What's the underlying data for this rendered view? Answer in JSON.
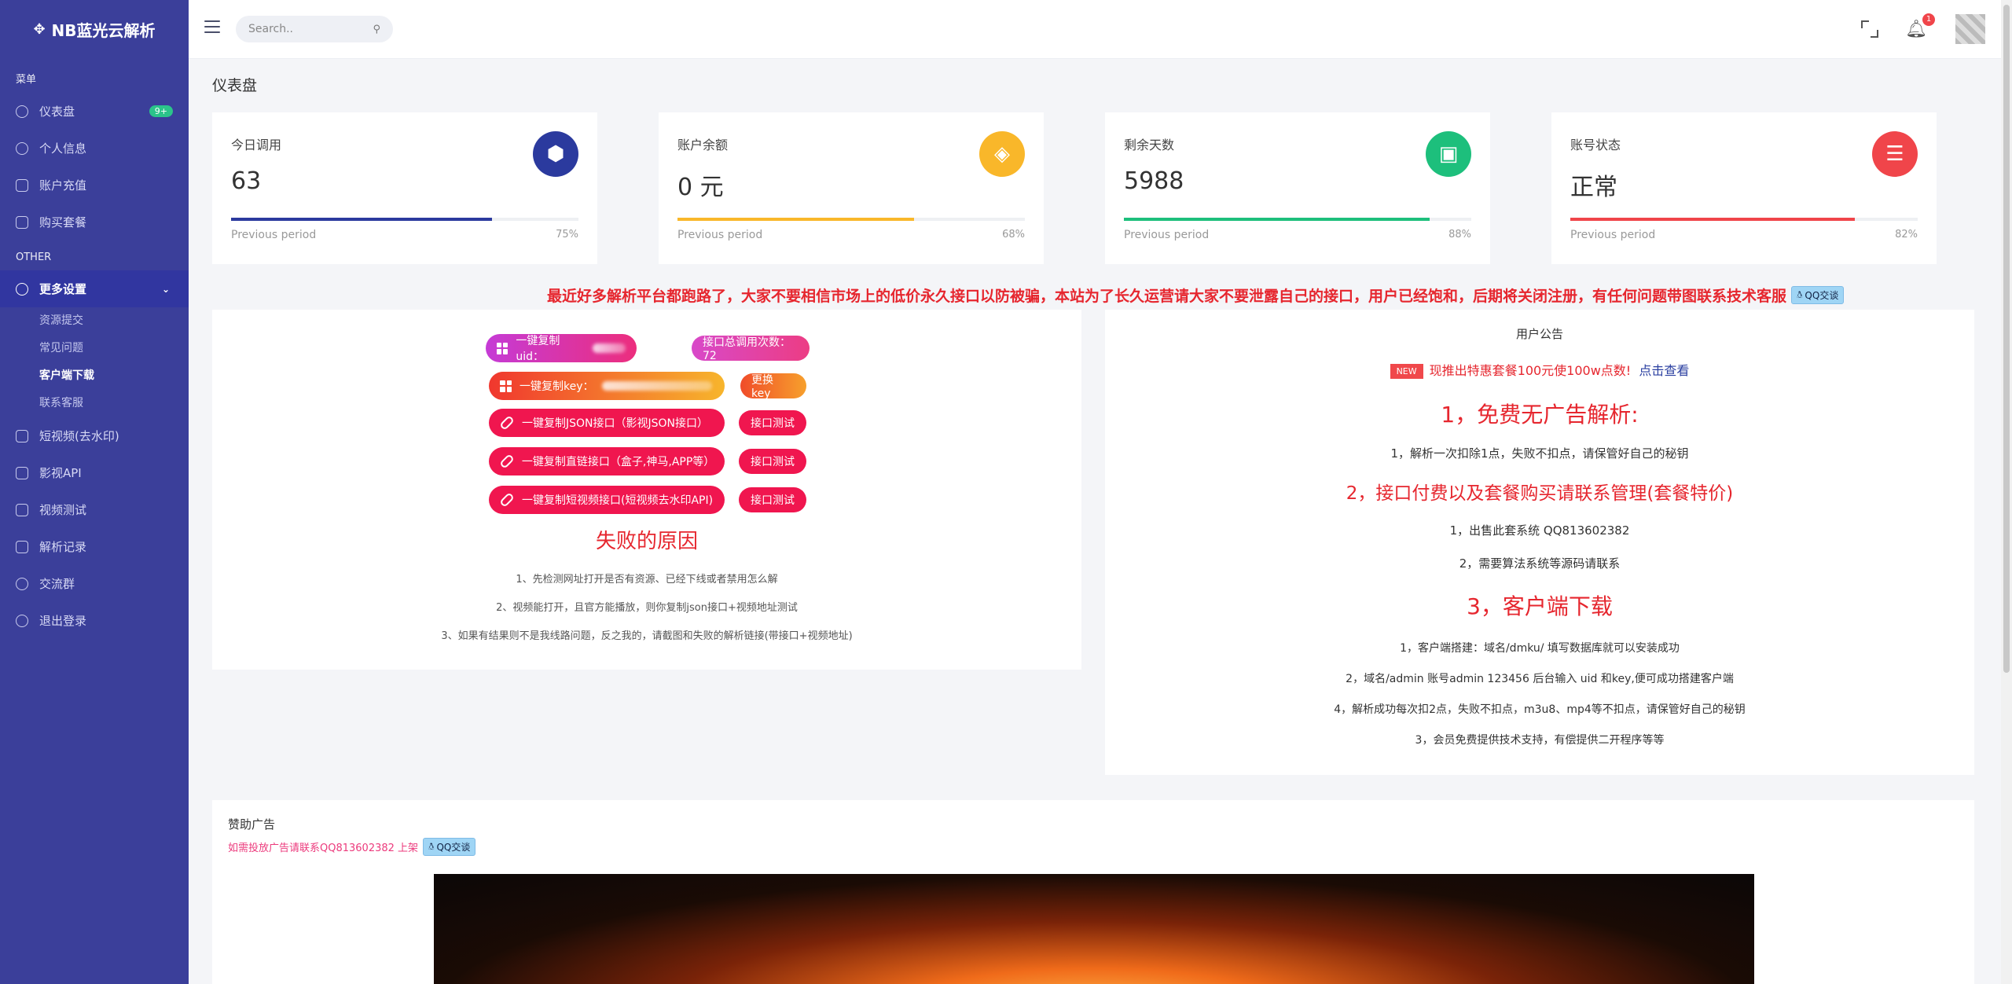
{
  "app": {
    "brand": "NB蓝光云解析"
  },
  "sidebar": {
    "section_menu": "菜单",
    "section_other": "OTHER",
    "items": [
      {
        "label": "仪表盘",
        "badge": "9+"
      },
      {
        "label": "个人信息"
      },
      {
        "label": "账户充值"
      },
      {
        "label": "购买套餐"
      }
    ],
    "more": {
      "label": "更多设置",
      "sub": [
        "资源提交",
        "常见问题",
        "客户端下载",
        "联系客服"
      ]
    },
    "items2": [
      {
        "label": "短视频(去水印)"
      },
      {
        "label": "影视API"
      },
      {
        "label": "视频测试"
      },
      {
        "label": "解析记录"
      },
      {
        "label": "交流群"
      },
      {
        "label": "退出登录"
      }
    ]
  },
  "topbar": {
    "search_placeholder": "Search..",
    "notif_count": "1"
  },
  "page": {
    "title": "仪表盘"
  },
  "stats": [
    {
      "label": "今日调用",
      "value": "63",
      "progress": 0.75,
      "percent": "75%",
      "prev": "Previous period",
      "color": "#2b3a9e",
      "icon": "cube-icon"
    },
    {
      "label": "账户余额",
      "value": "0 元",
      "progress": 0.68,
      "percent": "68%",
      "prev": "Previous period",
      "color": "#f9b72a",
      "icon": "tag-icon"
    },
    {
      "label": "剩余天数",
      "value": "5988",
      "progress": 0.88,
      "percent": "88%",
      "prev": "Previous period",
      "color": "#1dbf7c",
      "icon": "briefcase-icon"
    },
    {
      "label": "账号状态",
      "value": "正常",
      "progress": 0.82,
      "percent": "82%",
      "prev": "Previous period",
      "color": "#f0454a",
      "icon": "layers-icon"
    }
  ],
  "marquee": {
    "text": "最近好多解析平台都跑路了，大家不要相信市场上的低价永久接口以防被骗，本站为了长久运营请大家不要泄露自己的接口，用户已经饱和，后期将关闭注册，有任何问题带图联系技术客服",
    "qq_label": "QQ交谈"
  },
  "api": {
    "copy_uid": "一键复制uid：",
    "total_calls": "接口总调用次数：72",
    "copy_key": "一键复制key：",
    "change_key": "更换 key",
    "copy_json": "一键复制JSON接口（影视JSON接口）",
    "copy_direct": "一键复制直链接口（盒子,神马,APP等）",
    "copy_short": "一键复制短视频接口(短视频去水印API)",
    "test": "接口测试",
    "fail_title": "失败的原因",
    "reasons": [
      "1、先检测网址打开是否有资源、已经下线或者禁用怎么解",
      "2、视频能打开，且官方能播放，则你复制json接口+视频地址测试",
      "3、如果有结果则不是我线路问题，反之我的，请截图和失败的解析链接(带接口+视频地址)"
    ]
  },
  "notice": {
    "title": "用户公告",
    "new_badge": "NEW",
    "promo": "现推出特惠套餐100元使100w点数!",
    "promo_link": "点击查看",
    "h1": "1，免费无广告解析:",
    "l1": "1，解析一次扣除1点，失败不扣点，请保管好自己的秘钥",
    "h2": "2，接口付费以及套餐购买请联系管理(套餐特价)",
    "l2a": "1，出售此套系统 QQ813602382",
    "l2b": "2，需要算法系统等源码请联系",
    "h3": "3，客户端下载",
    "l3a": "1，客户端搭建：域名/dmku/ 填写数据库就可以安装成功",
    "l3b": "2，域名/admin 账号admin 123456 后台输入 uid 和key,便可成功搭建客户端",
    "l3c": "4，解析成功每次扣2点，失败不扣点，m3u8、mp4等不扣点，请保管好自己的秘钥",
    "l3d": "3，会员免费提供技术支持，有偿提供二开程序等等"
  },
  "ad": {
    "title": "赞助广告",
    "subtitle": "如需投放广告请联系QQ813602382 上架",
    "qq_label": "QQ交谈"
  }
}
